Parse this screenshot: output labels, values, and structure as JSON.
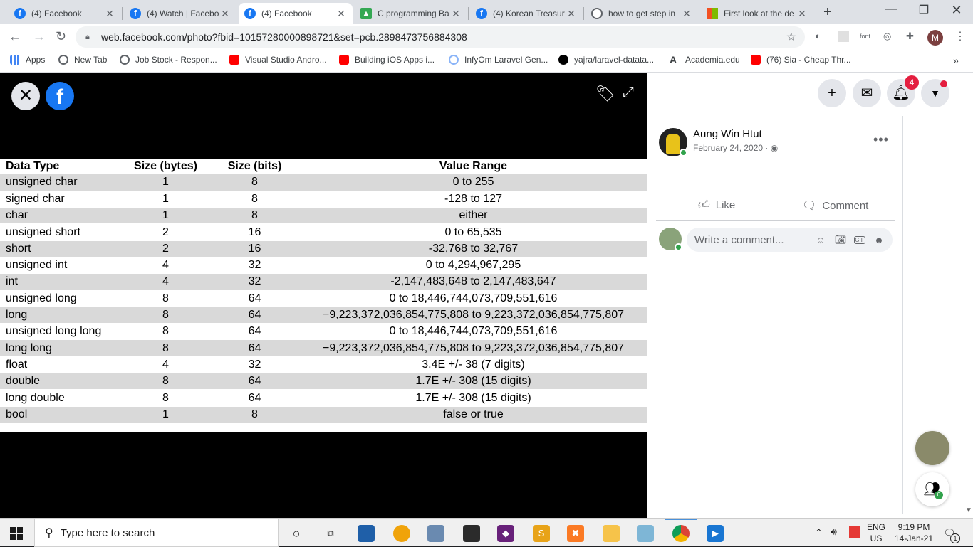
{
  "browser": {
    "tabs": [
      {
        "title": "(4) Facebook",
        "icon": "facebook-icon",
        "color": "#1877f2"
      },
      {
        "title": "(4) Watch | Facebo",
        "icon": "facebook-icon",
        "color": "#1877f2"
      },
      {
        "title": "(4) Facebook",
        "icon": "facebook-icon",
        "color": "#1877f2",
        "active": true
      },
      {
        "title": "C programming Ba",
        "icon": "google-drive-icon",
        "color": "#34a853"
      },
      {
        "title": "(4) Korean Treasur",
        "icon": "facebook-icon",
        "color": "#1877f2"
      },
      {
        "title": "how to get step in",
        "icon": "globe-icon",
        "color": "#5f6368"
      },
      {
        "title": "First look at the de",
        "icon": "microsoft-icon",
        "color": "#f25022"
      }
    ],
    "url": "web.facebook.com/photo?fbid=10157280000898721&set=pcb.2898473756884308",
    "extension_label": "font",
    "profile_initial": "M",
    "bookmarks": [
      {
        "label": "Apps",
        "icon": "apps-grid-icon",
        "color": "#4285f4"
      },
      {
        "label": "New Tab",
        "icon": "globe-icon",
        "color": "#5f6368"
      },
      {
        "label": "Job Stock - Respon...",
        "icon": "globe-icon",
        "color": "#5f6368"
      },
      {
        "label": "Visual Studio Andro...",
        "icon": "youtube-icon",
        "color": "#ff0000"
      },
      {
        "label": "Building iOS Apps i...",
        "icon": "youtube-icon",
        "color": "#ff0000"
      },
      {
        "label": "InfyOm Laravel Gen...",
        "icon": "infyom-icon",
        "color": "#8ab4f8"
      },
      {
        "label": "yajra/laravel-datata...",
        "icon": "github-icon",
        "color": "#000000"
      },
      {
        "label": "Academia.edu",
        "icon": "academia-icon",
        "color": "#000000"
      },
      {
        "label": "(76) Sia - Cheap Thr...",
        "icon": "youtube-icon",
        "color": "#ff0000"
      }
    ]
  },
  "photo_table": {
    "headers": [
      "Data Type",
      "Size (bytes)",
      "Size (bits)",
      "Value Range"
    ],
    "rows": [
      [
        "unsigned char",
        "1",
        "8",
        "0 to 255"
      ],
      [
        "signed char",
        "1",
        "8",
        "-128 to 127"
      ],
      [
        "char",
        "1",
        "8",
        "either"
      ],
      [
        "unsigned short",
        "2",
        "16",
        "0 to 65,535"
      ],
      [
        "short",
        "2",
        "16",
        "-32,768 to 32,767"
      ],
      [
        "unsigned int",
        "4",
        "32",
        "0 to 4,294,967,295"
      ],
      [
        "int",
        "4",
        "32",
        "-2,147,483,648 to 2,147,483,647"
      ],
      [
        "unsigned long",
        "8",
        "64",
        "0 to 18,446,744,073,709,551,616"
      ],
      [
        "long",
        "8",
        "64",
        "−9,223,372,036,854,775,808 to 9,223,372,036,854,775,807"
      ],
      [
        "unsigned long long",
        "8",
        "64",
        "0 to 18,446,744,073,709,551,616"
      ],
      [
        "long long",
        "8",
        "64",
        "−9,223,372,036,854,775,808 to 9,223,372,036,854,775,807"
      ],
      [
        "float",
        "4",
        "32",
        "3.4E +/- 38 (7 digits)"
      ],
      [
        "double",
        "8",
        "64",
        "1.7E +/- 308 (15 digits)"
      ],
      [
        "long double",
        "8",
        "64",
        "1.7E +/- 308 (15 digits)"
      ],
      [
        "bool",
        "1",
        "8",
        "false or true"
      ]
    ]
  },
  "panel": {
    "notification_count": "4",
    "post": {
      "author": "Aung Win Htut",
      "date": "February 24, 2020 · ◉"
    },
    "actions": {
      "like": "Like",
      "comment": "Comment"
    },
    "comment_placeholder": "Write a comment...",
    "contacts_badge": "0"
  },
  "taskbar": {
    "search_placeholder": "Type here to search",
    "lang_top": "ENG",
    "lang_bottom": "US",
    "time": "9:19 PM",
    "date": "14-Jan-21",
    "notification_count": "1"
  },
  "colors": {
    "facebook_blue": "#1877f2",
    "table_stripe": "#d9d9d9",
    "badge_red": "#e41e3f"
  }
}
